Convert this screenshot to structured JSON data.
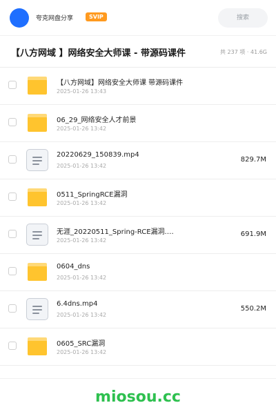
{
  "header": {
    "brand": "夸克网盘分享",
    "badge": "SVIP",
    "search_placeholder": "搜索"
  },
  "share": {
    "title": "【八方网域 】网络安全大师课 - 带源码课件",
    "meta": "共 237 项 · 41.6G"
  },
  "files": [
    {
      "type": "folder",
      "name": "【八方网域】网络安全大师课  带源码课件",
      "date": "2025-01-26 13:43",
      "size": ""
    },
    {
      "type": "folder",
      "name": "06_29_网络安全人才前景",
      "date": "2025-01-26 13:42",
      "size": ""
    },
    {
      "type": "file",
      "name": "20220629_150839.mp4",
      "date": "2025-01-26 13:42",
      "size": "829.7M"
    },
    {
      "type": "folder",
      "name": "0511_SpringRCE漏洞",
      "date": "2025-01-26 13:42",
      "size": ""
    },
    {
      "type": "file",
      "name": "无涯_20220511_Spring-RCE漏洞.…",
      "date": "2025-01-26 13:42",
      "size": "691.9M"
    },
    {
      "type": "folder",
      "name": "0604_dns",
      "date": "2025-01-26 13:42",
      "size": ""
    },
    {
      "type": "file",
      "name": "6.4dns.mp4",
      "date": "2025-01-26 13:42",
      "size": "550.2M"
    },
    {
      "type": "folder",
      "name": "0605_SRC漏洞",
      "date": "2025-01-26 13:42",
      "size": ""
    }
  ],
  "footer": {
    "watermark": "miosou.cc"
  },
  "colors": {
    "accent": "#1f6fff",
    "badge": "#ff9a1f",
    "folder": "#ffc42e",
    "watermark": "#2ec04f"
  }
}
